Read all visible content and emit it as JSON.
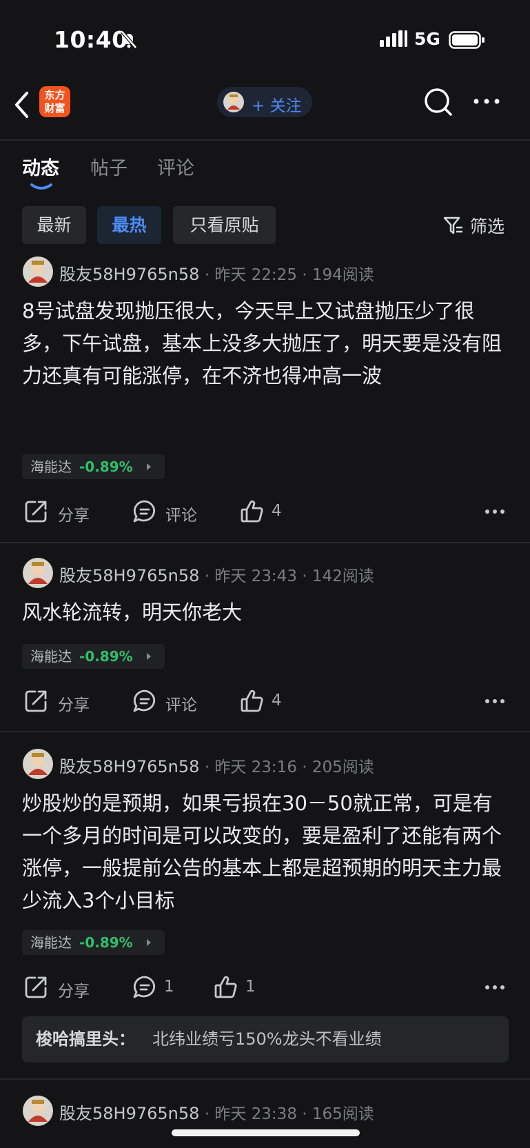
{
  "status_bar": {
    "time": "10:40",
    "network": "5G"
  },
  "nav": {
    "logo_line1": "东方",
    "logo_line2": "财富",
    "follow_label": "+ 关注"
  },
  "tabs": [
    {
      "label": "动态"
    },
    {
      "label": "帖子"
    },
    {
      "label": "评论"
    }
  ],
  "filters": {
    "chips": [
      {
        "label": "最新"
      },
      {
        "label": "最热"
      },
      {
        "label": "只看原贴"
      }
    ],
    "filter_label": "筛选",
    "active_chip": "最热"
  },
  "posts": [
    {
      "user": "股友58H9765n58",
      "time": "昨天 22:25",
      "reads": "194阅读",
      "content": "8号试盘发现抛压很大，今天早上又试盘抛压少了很多，下午试盘，基本上没多大抛压了，明天要是没有阻力还真有可能涨停，在不济也得冲高一波",
      "stock_name": "海能达",
      "stock_change": "-0.89%",
      "share": "分享",
      "comment": "评论",
      "likes": "4"
    },
    {
      "user": "股友58H9765n58",
      "time": "昨天 23:43",
      "reads": "142阅读",
      "content": "风水轮流转，明天你老大",
      "stock_name": "海能达",
      "stock_change": "-0.89%",
      "share": "分享",
      "comment": "评论",
      "likes": "4"
    },
    {
      "user": "股友58H9765n58",
      "time": "昨天 23:16",
      "reads": "205阅读",
      "content": "炒股炒的是预期，如果亏损在30－50就正常，可是有一个多月的时间是可以改变的，要是盈利了还能有两个涨停，一般提前公告的基本上都是超预期的明天主力最少流入3个小目标",
      "stock_name": "海能达",
      "stock_change": "-0.89%",
      "share": "分享",
      "comment": "1",
      "likes": "1",
      "reply_user": "梭哈搞里头：",
      "reply_text": "北纬业绩亏150%龙头不看业绩"
    },
    {
      "user": "股友58H9765n58",
      "time": "昨天 23:38",
      "reads": "165阅读"
    }
  ],
  "colors": {
    "background": "#141416",
    "accent_blue": "#4d8cf5",
    "gain_green": "#2fbf6a",
    "logo_orange": "#f3531f"
  },
  "icons": [
    "bell-muted-icon",
    "signal-icon",
    "battery-icon",
    "back-chevron-icon",
    "search-icon",
    "more-icon",
    "filter-icon",
    "share-icon",
    "comment-icon",
    "like-icon",
    "avatar-icon"
  ]
}
